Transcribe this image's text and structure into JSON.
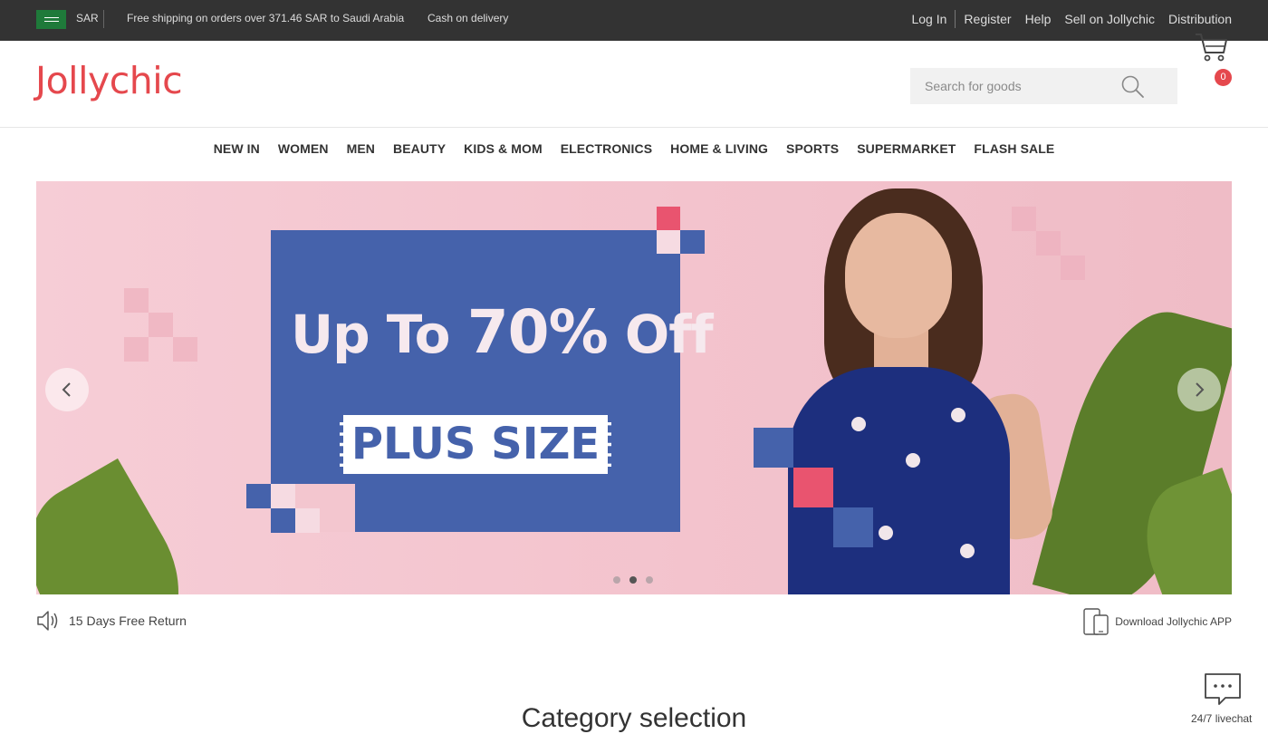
{
  "topbar": {
    "currency": "SAR",
    "shipping_notice": "Free shipping on orders over 371.46 SAR to Saudi Arabia",
    "cod_notice": "Cash on delivery",
    "links": {
      "login": "Log In",
      "register": "Register",
      "help": "Help",
      "sell": "Sell on Jollychic",
      "distribution": "Distribution"
    }
  },
  "header": {
    "logo": "Jollychic",
    "search_placeholder": "Search for goods",
    "cart_count": "0"
  },
  "nav": {
    "items": [
      "NEW IN",
      "WOMEN",
      "MEN",
      "BEAUTY",
      "KIDS & MOM",
      "ELECTRONICS",
      "HOME & LIVING",
      "SPORTS",
      "SUPERMARKET",
      "FLASH SALE"
    ]
  },
  "banner": {
    "headline_a": "Up To ",
    "headline_b": "70%",
    "headline_c": " Off",
    "label": "PLUS SIZE",
    "active_slide": 2,
    "slide_count": 3
  },
  "notice": {
    "text": "15 Days Free Return"
  },
  "app": {
    "text": "Download Jollychic APP"
  },
  "section": {
    "title": "Category selection"
  },
  "livechat": {
    "label": "24/7 livechat"
  },
  "colors": {
    "brand": "#e5484d",
    "topbar": "#333333",
    "promo_blue": "#4562ab",
    "banner_pink": "#f3c6cf"
  },
  "icons": [
    "flag-icon",
    "search-icon",
    "cart-icon",
    "chevron-left-icon",
    "chevron-right-icon",
    "speaker-icon",
    "phone-icon",
    "chat-icon"
  ]
}
